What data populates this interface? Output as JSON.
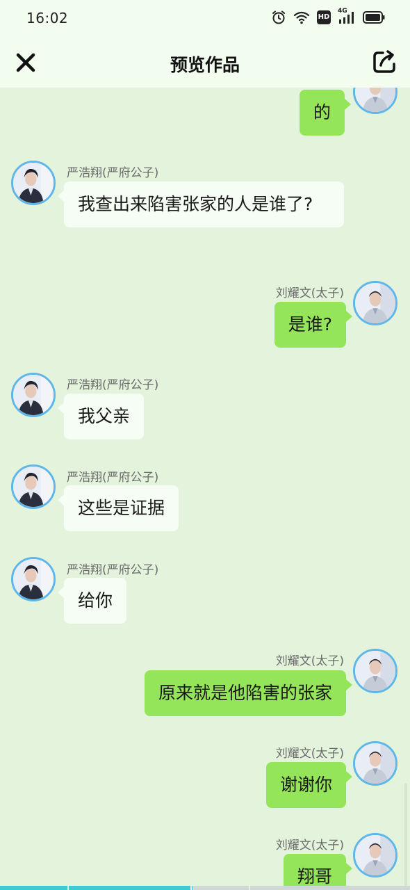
{
  "status_bar": {
    "time": "16:02",
    "icons": [
      "alarm-icon",
      "wifi-icon",
      "hd-icon",
      "signal-4g-icon",
      "battery-icon"
    ],
    "hd_label": "HD",
    "network_label": "4G"
  },
  "header": {
    "title": "预览作品",
    "close_icon": "close-icon",
    "share_icon": "share-icon"
  },
  "colors": {
    "background": "#e4f4dc",
    "header_bg": "#f2fcef",
    "bubble_left": "#f6fdf4",
    "bubble_right": "#95e55a",
    "avatar_ring": "#5eb7e8",
    "progress": "#41c8d6"
  },
  "messages": [
    {
      "side": "right",
      "sender": "",
      "text": "的"
    },
    {
      "side": "left",
      "sender": "严浩翔(严府公子)",
      "text": "我查出来陷害张家的人是谁了?"
    },
    {
      "side": "right",
      "sender": "刘耀文(太子)",
      "text": "是谁?"
    },
    {
      "side": "left",
      "sender": "严浩翔(严府公子)",
      "text": "我父亲"
    },
    {
      "side": "left",
      "sender": "严浩翔(严府公子)",
      "text": "这些是证据"
    },
    {
      "side": "left",
      "sender": "严浩翔(严府公子)",
      "text": "给你"
    },
    {
      "side": "right",
      "sender": "刘耀文(太子)",
      "text": "原来就是他陷害的张家"
    },
    {
      "side": "right",
      "sender": "刘耀文(太子)",
      "text": "谢谢你"
    },
    {
      "side": "right",
      "sender": "刘耀文(太子)",
      "text": "翔哥"
    }
  ],
  "playback_progress": 0.47
}
